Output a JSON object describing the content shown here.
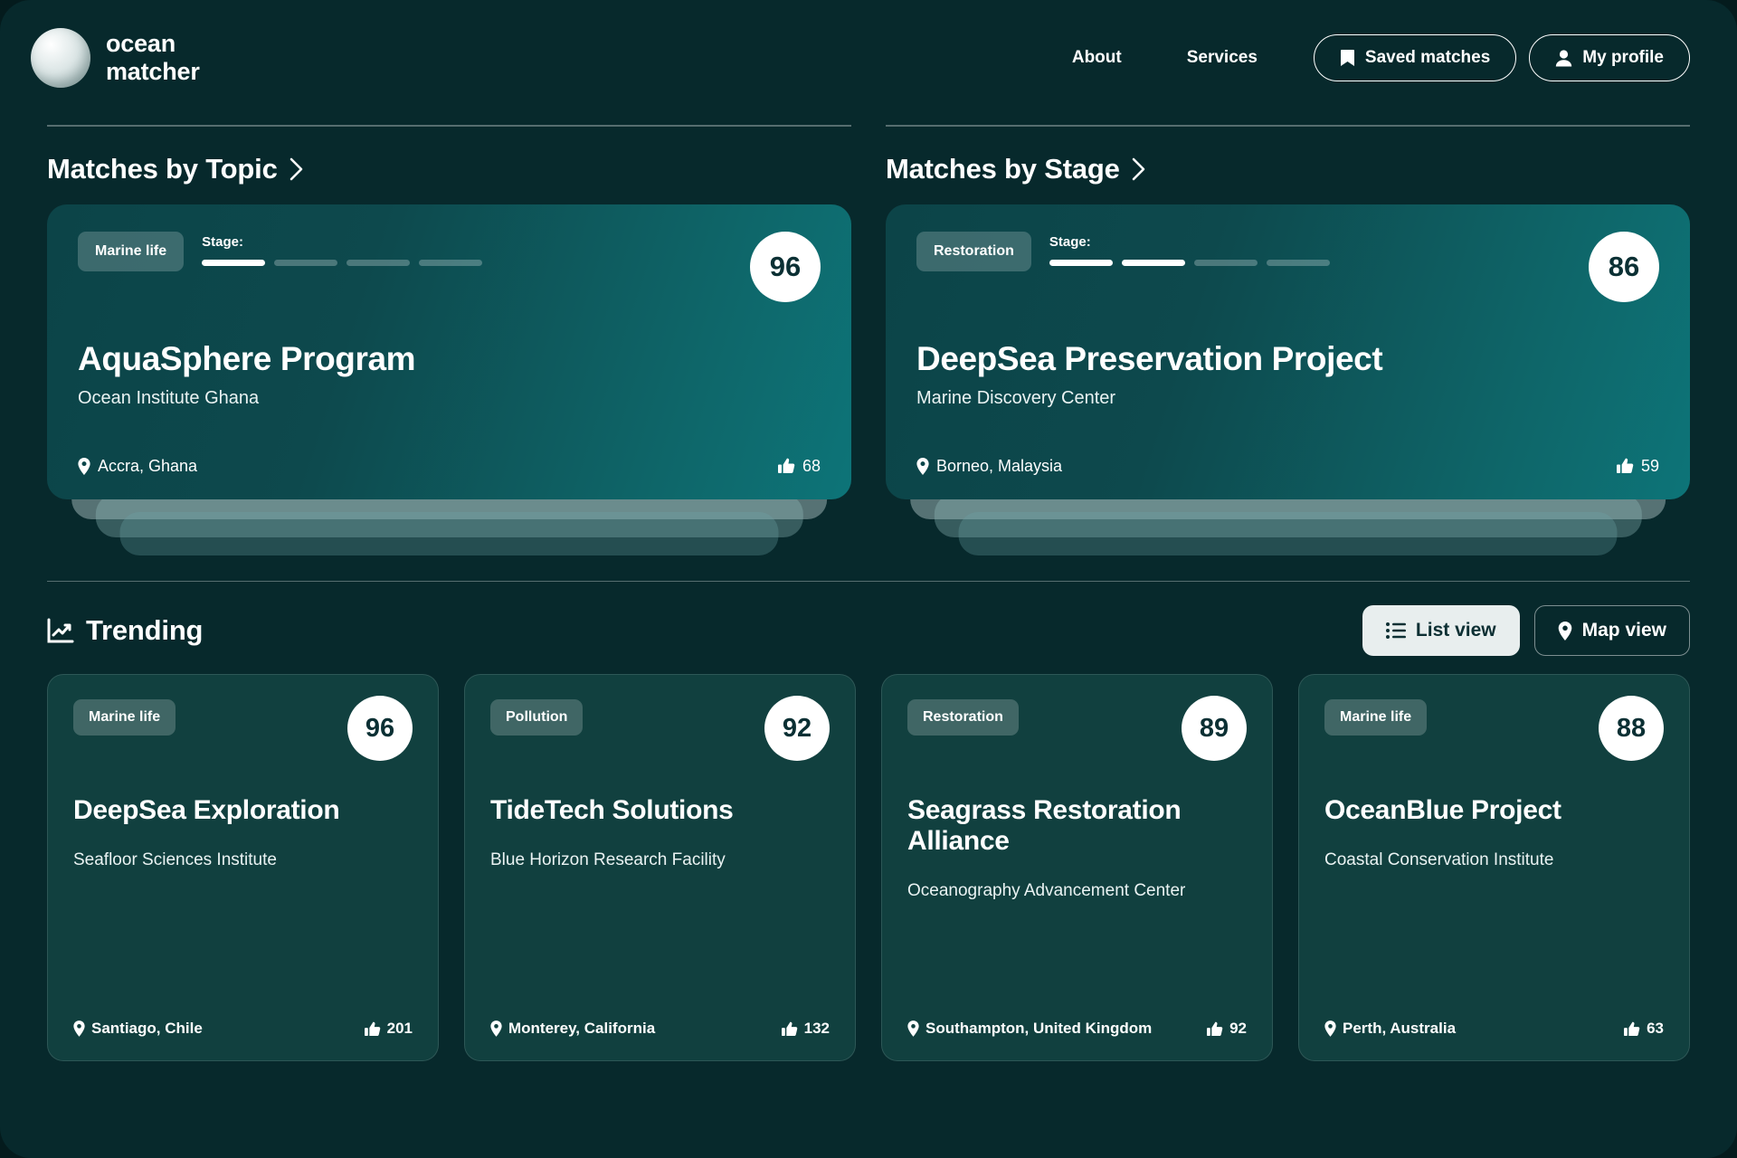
{
  "brand": {
    "line1": "ocean",
    "line2": "matcher",
    "logo_icon": "sphere-logo"
  },
  "nav": {
    "about": "About",
    "services": "Services",
    "saved_matches": "Saved matches",
    "my_profile": "My profile",
    "saved_icon": "bookmark-icon",
    "profile_icon": "person-icon"
  },
  "colors": {
    "page_bg": "#07292c",
    "card_gradient_start": "#0c4448",
    "card_gradient_end": "#0d7478",
    "trend_card_bg": "#11403f",
    "score_bg": "#ffffff",
    "score_text": "#0b3034",
    "accent_light": "#e8eeee"
  },
  "sections": [
    {
      "title": "Matches by Topic",
      "chevron_icon": "chevron-right-icon",
      "card": {
        "topic": "Marine life",
        "stage_label": "Stage:",
        "stage_total": 4,
        "stage_active": 1,
        "score": "96",
        "name": "AquaSphere Program",
        "org": "Ocean Institute Ghana",
        "location": "Accra, Ghana",
        "likes": "68",
        "location_icon": "map-pin-icon",
        "likes_icon": "thumbs-up-icon"
      }
    },
    {
      "title": "Matches by Stage",
      "chevron_icon": "chevron-right-icon",
      "card": {
        "topic": "Restoration",
        "stage_label": "Stage:",
        "stage_total": 4,
        "stage_active": 2,
        "score": "86",
        "name": "DeepSea Preservation Project",
        "org": "Marine Discovery Center",
        "location": "Borneo, Malaysia",
        "likes": "59",
        "location_icon": "map-pin-icon",
        "likes_icon": "thumbs-up-icon"
      }
    }
  ],
  "trending": {
    "title": "Trending",
    "title_icon": "trending-chart-icon",
    "list_view": "List view",
    "map_view": "Map view",
    "list_icon": "list-icon",
    "map_icon": "map-pin-icon",
    "active_view": "List view",
    "cards": [
      {
        "topic": "Marine life",
        "score": "96",
        "name": "DeepSea Exploration",
        "org": "Seafloor Sciences Institute",
        "location": "Santiago, Chile",
        "likes": "201"
      },
      {
        "topic": "Pollution",
        "score": "92",
        "name": "TideTech Solutions",
        "org": "Blue Horizon Research Facility",
        "location": "Monterey, California",
        "likes": "132"
      },
      {
        "topic": "Restoration",
        "score": "89",
        "name": "Seagrass Restoration Alliance",
        "org": "Oceanography Advancement Center",
        "location": "Southampton, United Kingdom",
        "likes": "92"
      },
      {
        "topic": "Marine life",
        "score": "88",
        "name": "OceanBlue Project",
        "org": "Coastal Conservation Institute",
        "location": "Perth, Australia",
        "likes": "63"
      }
    ]
  }
}
